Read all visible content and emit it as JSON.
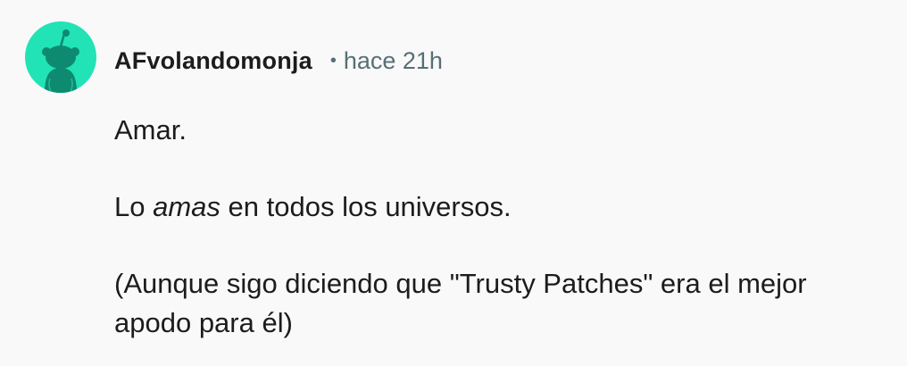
{
  "comment": {
    "avatar_icon": "snoo-avatar-icon",
    "avatar_color": "#21e3b6",
    "username": "AFvolandomonja",
    "separator": "•",
    "time": "hace 21h",
    "paragraphs": {
      "p1": "Amar.",
      "p2": {
        "before": "Lo ",
        "emphasis": "amas",
        "after": " en todos los universos."
      },
      "p3": "(Aunque sigo diciendo que \"Trusty Patches\" era el mejor apodo para él)"
    }
  }
}
